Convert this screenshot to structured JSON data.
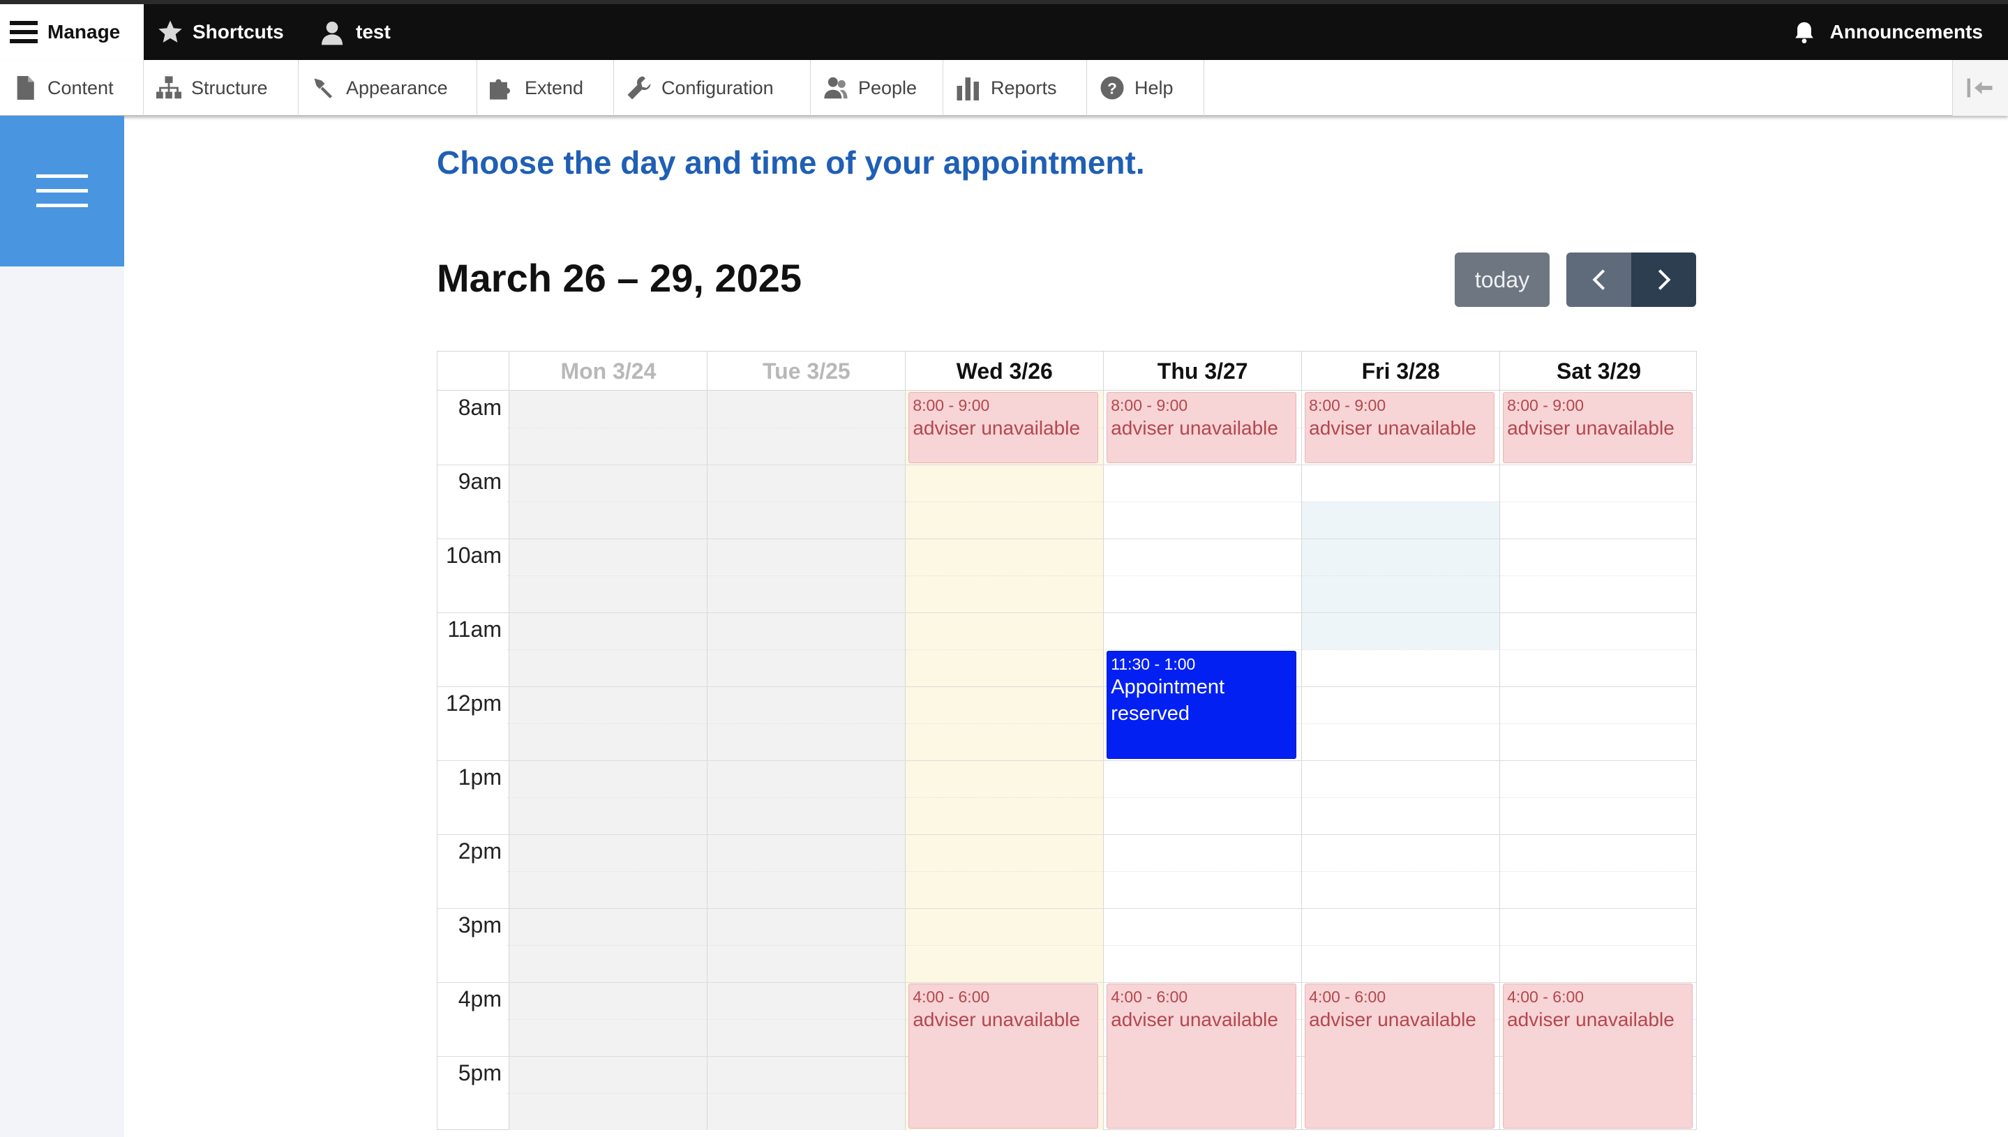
{
  "toolbar": {
    "manage_label": "Manage",
    "shortcuts_label": "Shortcuts",
    "user_label": "test",
    "announcements_label": "Announcements"
  },
  "tray": {
    "items": [
      {
        "label": "Content",
        "icon": "file-icon"
      },
      {
        "label": "Structure",
        "icon": "sitemap-icon"
      },
      {
        "label": "Appearance",
        "icon": "paintbrush-icon"
      },
      {
        "label": "Extend",
        "icon": "puzzle-icon"
      },
      {
        "label": "Configuration",
        "icon": "wrench-icon"
      },
      {
        "label": "People",
        "icon": "people-icon"
      },
      {
        "label": "Reports",
        "icon": "bar-chart-icon"
      },
      {
        "label": "Help",
        "icon": "help-icon"
      }
    ]
  },
  "page": {
    "headline": "Choose the day and time of your appointment."
  },
  "calendar": {
    "range_title": "March 26 – 29, 2025",
    "today_label": "today",
    "days": [
      {
        "label": "Mon 3/24",
        "past": true
      },
      {
        "label": "Tue 3/25",
        "past": true
      },
      {
        "label": "Wed 3/26",
        "past": false,
        "today": true
      },
      {
        "label": "Thu 3/27",
        "past": false
      },
      {
        "label": "Fri 3/28",
        "past": false
      },
      {
        "label": "Sat 3/29",
        "past": false
      }
    ],
    "hours": [
      "8am",
      "9am",
      "10am",
      "11am",
      "12pm",
      "1pm",
      "2pm",
      "3pm",
      "4pm",
      "5pm"
    ],
    "events": [
      {
        "day": 2,
        "start": 8,
        "end": 9,
        "time": "8:00 - 9:00",
        "title": "adviser unavailable",
        "kind": "unavailable"
      },
      {
        "day": 3,
        "start": 8,
        "end": 9,
        "time": "8:00 - 9:00",
        "title": "adviser unavailable",
        "kind": "unavailable"
      },
      {
        "day": 4,
        "start": 8,
        "end": 9,
        "time": "8:00 - 9:00",
        "title": "adviser unavailable",
        "kind": "unavailable"
      },
      {
        "day": 5,
        "start": 8,
        "end": 9,
        "time": "8:00 - 9:00",
        "title": "adviser unavailable",
        "kind": "unavailable"
      },
      {
        "day": 3,
        "start": 11.5,
        "end": 13,
        "time": "11:30 - 1:00",
        "title": "Appointment reserved",
        "kind": "booked"
      },
      {
        "day": 2,
        "start": 16,
        "end": 18,
        "time": "4:00 - 6:00",
        "title": "adviser unavailable",
        "kind": "unavailable"
      },
      {
        "day": 3,
        "start": 16,
        "end": 18,
        "time": "4:00 - 6:00",
        "title": "adviser unavailable",
        "kind": "unavailable"
      },
      {
        "day": 4,
        "start": 16,
        "end": 18,
        "time": "4:00 - 6:00",
        "title": "adviser unavailable",
        "kind": "unavailable"
      },
      {
        "day": 5,
        "start": 16,
        "end": 18,
        "time": "4:00 - 6:00",
        "title": "adviser unavailable",
        "kind": "unavailable"
      }
    ],
    "highlight": {
      "day": 4,
      "start": 9.5,
      "end": 11.5
    },
    "colors": {
      "unavailable_bg": "#f7d4d5",
      "unavailable_text": "#b3474f",
      "booked_bg": "#0320f3",
      "today_bg": "#fcf8e3",
      "headline": "#1f5fb5",
      "menu_blue": "#4a95e0"
    }
  }
}
